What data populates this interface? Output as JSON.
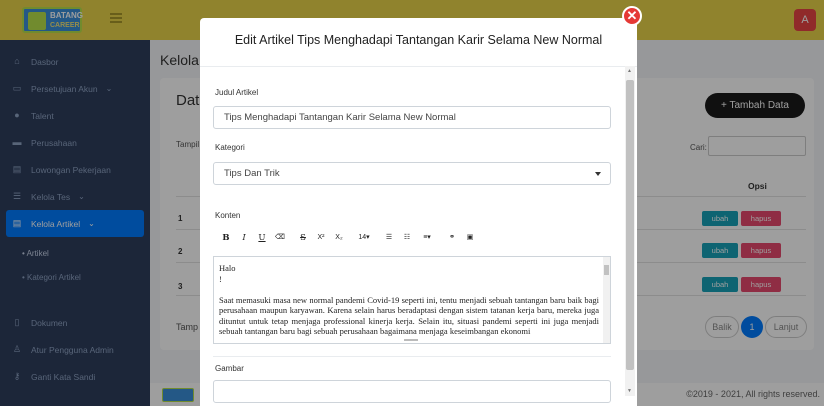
{
  "app": {
    "logo_line1": "BATANG",
    "logo_line2": "CAREER",
    "avatar_letter": "A"
  },
  "sidebar": {
    "items": [
      {
        "label": "Dasbor",
        "icon": "home-icon"
      },
      {
        "label": "Persetujuan Akun",
        "icon": "user-check-icon",
        "has_chevron": true
      },
      {
        "label": "Talent",
        "icon": "user-icon"
      },
      {
        "label": "Perusahaan",
        "icon": "building-icon"
      },
      {
        "label": "Lowongan Pekerjaan",
        "icon": "briefcase-icon"
      },
      {
        "label": "Kelola Tes",
        "icon": "list-icon",
        "has_chevron": true
      },
      {
        "label": "Kelola Artikel",
        "icon": "newspaper-icon",
        "has_chevron": true,
        "active": true
      }
    ],
    "subitems": [
      {
        "label": "• Artikel",
        "active": true
      },
      {
        "label": "• Kategori Artikel"
      }
    ],
    "bottom_items": [
      {
        "label": "Dokumen",
        "icon": "document-icon"
      },
      {
        "label": "Atur Pengguna Admin",
        "icon": "user-cog-icon"
      },
      {
        "label": "Ganti Kata Sandi",
        "icon": "key-icon"
      }
    ]
  },
  "main": {
    "title": "Kelola",
    "card_title": "Dat",
    "add_button": "+ Tambah Data",
    "show_label": "Tampil",
    "search_label": "Cari:",
    "search_value": "",
    "column_options": "Opsi",
    "rows": [
      {
        "num": "1",
        "edit": "ubah",
        "delete": "hapus"
      },
      {
        "num": "2",
        "edit": "ubah",
        "delete": "hapus"
      },
      {
        "num": "3",
        "edit": "ubah",
        "delete": "hapus"
      }
    ],
    "footer_show": "Tamp",
    "pagination": {
      "prev": "Balik",
      "current": "1",
      "next": "Lanjut"
    }
  },
  "footer": {
    "copyright": "©2019 - 2021, All rights reserved."
  },
  "modal": {
    "title": "Edit Artikel Tips Menghadapi Tantangan Karir Selama New Normal",
    "fields": {
      "title_label": "Judul Artikel",
      "title_value": "Tips Menghadapi Tantangan Karir Selama New Normal",
      "category_label": "Kategori",
      "category_value": "Tips Dan Trik",
      "content_label": "Konten",
      "image_label": "Gambar"
    },
    "toolbar": {
      "bold": "B",
      "italic": "I",
      "underline": "U",
      "eraser": "⌫",
      "strike": "S",
      "superscript": "X²",
      "subscript": "X₂",
      "font_size": "14▾",
      "ul": "☰",
      "ol": "☷",
      "align": "≡▾",
      "link": "⚭",
      "image": "▣"
    },
    "content": {
      "line1": "Halo",
      "line2": "!",
      "paragraph": "Saat memasuki masa new normal pandemi Covid-19 seperti ini, tentu menjadi sebuah tantangan baru baik bagi perusahaan maupun karyawan. Karena selain harus beradaptasi dengan sistem tatanan kerja baru, mereka juga dituntut untuk tetap menjaga professional kinerja kerja. Selain itu, situasi pandemi seperti ini juga menjadi sebuah tantangan baru bagi sebuah perusahaan bagaimana menjaga keseimbangan ekonomi"
    },
    "close_symbol": "✕"
  },
  "colors": {
    "topbar": "#e8d44a",
    "sidebar": "#2e3e5c",
    "active": "#007bff",
    "close": "#e53935",
    "edit": "#17a2b8",
    "delete": "#e74a6e"
  }
}
